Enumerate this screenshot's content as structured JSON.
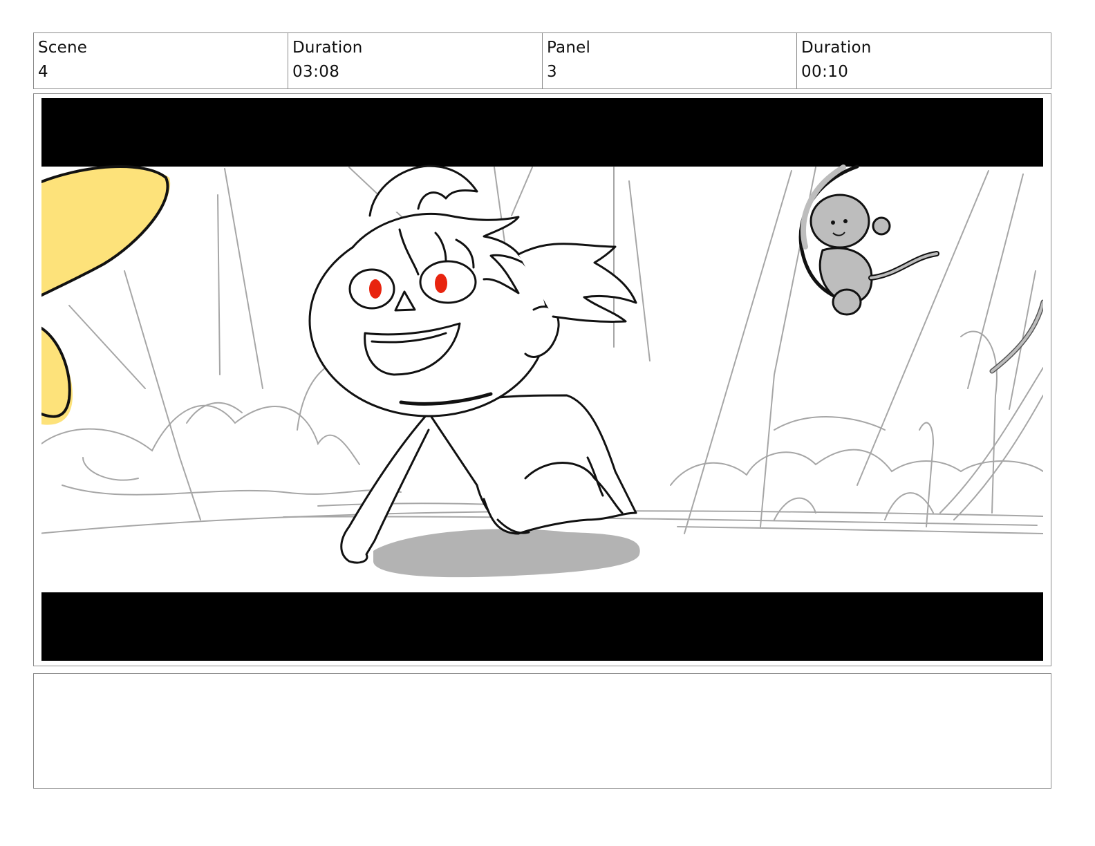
{
  "header": {
    "scene_label": "Scene",
    "scene_value": "4",
    "scene_duration_label": "Duration",
    "scene_duration_value": "03:08",
    "panel_label": "Panel",
    "panel_value": "3",
    "panel_duration_label": "Duration",
    "panel_duration_value": "00:10"
  },
  "panel": {
    "image_description_icon": "storyboard-sketch",
    "colors": {
      "letterbox": "#000000",
      "background": "#ffffff",
      "sketch_gray": "#a6a6a6",
      "ink": "#111111",
      "eye_red": "#e8240f",
      "leaf_yellow": "#fde27a",
      "shadow_gray": "#b3b3b3",
      "monkey_gray": "#bdbdbd"
    }
  },
  "notes": {
    "text": ""
  }
}
